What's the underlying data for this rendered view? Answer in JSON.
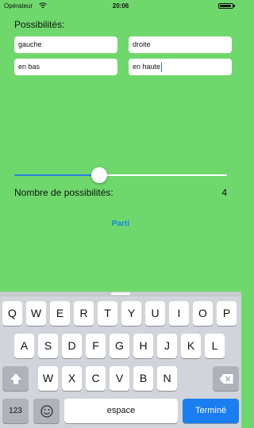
{
  "status_bar": {
    "carrier": "Opérateur",
    "time": "20:06",
    "battery_level": 0.9
  },
  "form": {
    "title": "Possibilités:",
    "fields": [
      {
        "value": "gauche"
      },
      {
        "value": "droite"
      },
      {
        "value": "en bas"
      },
      {
        "value": "en haute"
      }
    ],
    "slider": {
      "min": 0,
      "max": 10,
      "value": 4
    },
    "count_label": "Nombre de possibilités:",
    "count_value": "4",
    "go_button": "Parti"
  },
  "keyboard": {
    "row1": [
      "Q",
      "W",
      "E",
      "R",
      "T",
      "Y",
      "U",
      "I",
      "O",
      "P"
    ],
    "row2": [
      "A",
      "S",
      "D",
      "F",
      "G",
      "H",
      "J",
      "K",
      "L"
    ],
    "row3": [
      "W",
      "X",
      "C",
      "V",
      "B",
      "N"
    ],
    "numbers_key": "123",
    "space_key": "espace",
    "return_key": "Terminé",
    "icons": {
      "shift": "shift-icon",
      "delete": "backspace-icon",
      "emoji": "emoji-icon"
    }
  },
  "colors": {
    "background": "#6fd86c",
    "accent": "#1a85ea",
    "return_key": "#1a7ef0"
  }
}
